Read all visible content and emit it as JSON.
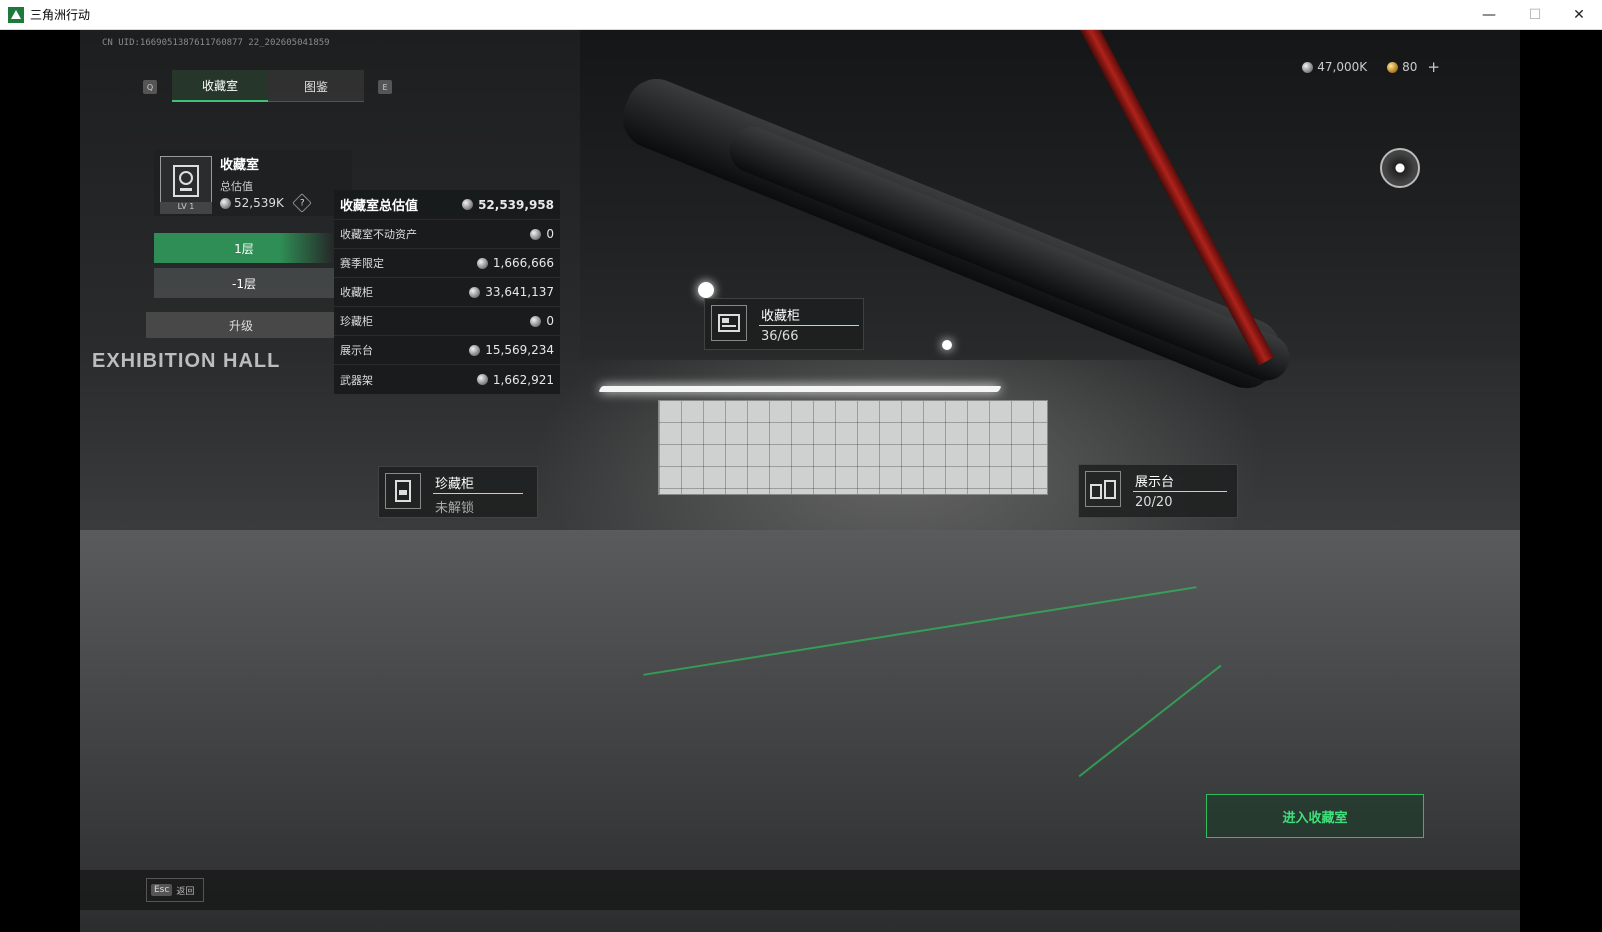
{
  "window": {
    "title": "三角洲行动",
    "minimize": "—",
    "maximize": "☐",
    "close": "✕"
  },
  "uid": "CN UID:1669051387611760877 22_202605041859",
  "tabs": [
    {
      "label": "收藏室",
      "active": true
    },
    {
      "label": "图鉴",
      "active": false
    }
  ],
  "tab_keys": {
    "left": "Q",
    "right": "E"
  },
  "currency": {
    "silver": "47,000K",
    "gold": "80",
    "add": "+"
  },
  "vault": {
    "title": "收藏室",
    "level": "LV 1",
    "subtitle": "总估值",
    "value": "52,539K",
    "help": "?"
  },
  "floors": [
    {
      "label": "1层",
      "active": true
    },
    {
      "label": "-1层",
      "active": false
    }
  ],
  "upgrade_label": "升级",
  "valuation": {
    "title": "收藏室总估值",
    "total": "52,539,958",
    "rows": [
      {
        "label": "收藏室不动资产",
        "value": "0"
      },
      {
        "label": "赛季限定",
        "value": "1,666,666"
      },
      {
        "label": "收藏柜",
        "value": "33,641,137"
      },
      {
        "label": "珍藏柜",
        "value": "0"
      },
      {
        "label": "展示台",
        "value": "15,569,234"
      },
      {
        "label": "武器架",
        "value": "1,662,921"
      }
    ]
  },
  "markers": {
    "cabinet": {
      "title": "收藏柜",
      "value": "36/66"
    },
    "treasure": {
      "title": "珍藏柜",
      "value": "未解锁"
    },
    "display": {
      "title": "展示台",
      "value": "20/20"
    }
  },
  "scene_text": "EXHIBITION HALL",
  "enter_button": "进入收藏室",
  "esc": {
    "key": "Esc",
    "label": "返回"
  },
  "colors": {
    "accent_green": "#3ec173",
    "pipe_red": "#b0221b"
  }
}
